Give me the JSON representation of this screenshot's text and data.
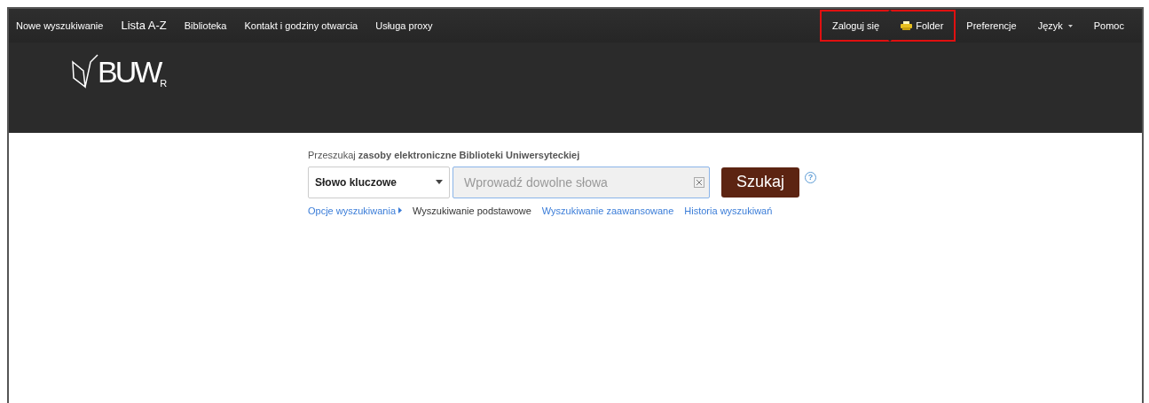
{
  "nav_left": [
    {
      "label": "Nowe wyszukiwanie",
      "kind": "normal"
    },
    {
      "label": "Lista A-Z",
      "kind": "large"
    },
    {
      "label": "Biblioteka",
      "kind": "normal"
    },
    {
      "label": "Kontakt i godziny otwarcia",
      "kind": "normal"
    },
    {
      "label": "Usługa proxy",
      "kind": "normal"
    }
  ],
  "nav_right": [
    {
      "label": "Zaloguj się",
      "kind": "normal",
      "highlighted": true
    },
    {
      "label": "Folder",
      "kind": "folder",
      "highlighted": true
    },
    {
      "label": "Preferencje",
      "kind": "normal",
      "highlighted": false
    },
    {
      "label": "Język",
      "kind": "menu",
      "highlighted": false
    },
    {
      "label": "Pomoc",
      "kind": "normal",
      "highlighted": false
    }
  ],
  "logo": {
    "text": "BUW",
    "mark": "R"
  },
  "search": {
    "heading": "Przeszukaj **zasoby elektroniczne Biblioteki Uniwersyteckiej**",
    "field_type": "Słowo kluczowe",
    "placeholder": "Wprowadź dowolne słowa",
    "button": "Szukaj",
    "help": "?"
  },
  "search_links": [
    {
      "label": "Opcje wyszukiwania",
      "kind": "expander",
      "selected": false
    },
    {
      "label": "Wyszukiwanie podstawowe",
      "kind": "link",
      "selected": true
    },
    {
      "label": "Wyszukiwanie zaawansowane",
      "kind": "link",
      "selected": false
    },
    {
      "label": "Historia wyszukiwań",
      "kind": "link",
      "selected": false
    }
  ]
}
